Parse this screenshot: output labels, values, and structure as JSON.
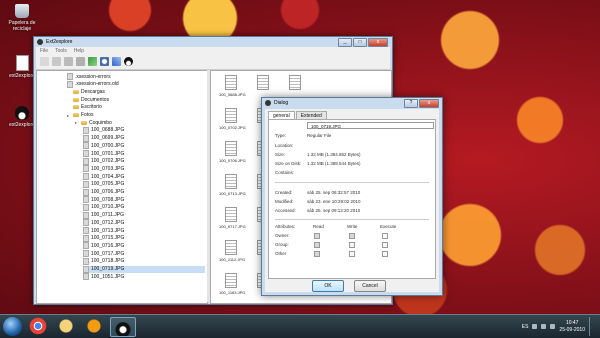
{
  "desktop": {
    "icons": [
      {
        "label": "Papelera de reciclaje"
      },
      {
        "label": "ext2explore"
      },
      {
        "label": "ext2explore"
      }
    ]
  },
  "main_window": {
    "title": "Ext2explore",
    "menu": [
      "File",
      "Tools",
      "Help"
    ],
    "close_label": "x",
    "tree": [
      {
        "label": ".xsession-errors",
        "type": "file",
        "indent": 0
      },
      {
        "label": ".xsession-errors.old",
        "type": "file",
        "indent": 0
      },
      {
        "label": "Descargas",
        "type": "folder",
        "indent": 0
      },
      {
        "label": "Documentos",
        "type": "folder",
        "indent": 0
      },
      {
        "label": "Escritorio",
        "type": "folder",
        "indent": 0
      },
      {
        "label": "Fotos",
        "type": "folder",
        "indent": 0
      },
      {
        "label": "Coquimbo",
        "type": "folder",
        "indent": 1
      },
      {
        "label": "100_0688.JPG",
        "type": "file",
        "indent": 2
      },
      {
        "label": "100_0699.JPG",
        "type": "file",
        "indent": 2
      },
      {
        "label": "100_0700.JPG",
        "type": "file",
        "indent": 2
      },
      {
        "label": "100_0701.JPG",
        "type": "file",
        "indent": 2
      },
      {
        "label": "100_0702.JPG",
        "type": "file",
        "indent": 2
      },
      {
        "label": "100_0703.JPG",
        "type": "file",
        "indent": 2
      },
      {
        "label": "100_0704.JPG",
        "type": "file",
        "indent": 2
      },
      {
        "label": "100_0705.JPG",
        "type": "file",
        "indent": 2
      },
      {
        "label": "100_0706.JPG",
        "type": "file",
        "indent": 2
      },
      {
        "label": "100_0708.JPG",
        "type": "file",
        "indent": 2
      },
      {
        "label": "100_0710.JPG",
        "type": "file",
        "indent": 2
      },
      {
        "label": "100_0711.JPG",
        "type": "file",
        "indent": 2
      },
      {
        "label": "100_0712.JPG",
        "type": "file",
        "indent": 2
      },
      {
        "label": "100_0713.JPG",
        "type": "file",
        "indent": 2
      },
      {
        "label": "100_0715.JPG",
        "type": "file",
        "indent": 2
      },
      {
        "label": "100_0716.JPG",
        "type": "file",
        "indent": 2
      },
      {
        "label": "100_0717.JPG",
        "type": "file",
        "indent": 2
      },
      {
        "label": "100_0718.JPG",
        "type": "file",
        "indent": 2
      },
      {
        "label": "100_0719.JPG",
        "type": "file",
        "indent": 2,
        "selected": true
      },
      {
        "label": "100_1051.JPG",
        "type": "file",
        "indent": 2
      }
    ],
    "thumbs": [
      {
        "label": ""
      },
      {
        "label": ""
      },
      {
        "label": ""
      },
      {
        "label": "100_0688.JPG"
      },
      {
        "label": ""
      },
      {
        "label": ""
      },
      {
        "label": ""
      },
      {
        "label": ""
      },
      {
        "label": ""
      },
      {
        "label": "100_0702.JPG"
      },
      {
        "label": ""
      },
      {
        "label": ""
      },
      {
        "label": ""
      },
      {
        "label": ""
      },
      {
        "label": ""
      },
      {
        "label": "100_0706.JPG"
      },
      {
        "label": ""
      },
      {
        "label": ""
      },
      {
        "label": ""
      },
      {
        "label": ""
      },
      {
        "label": ""
      },
      {
        "label": "100_0713.JPG"
      },
      {
        "label": ""
      },
      {
        "label": ""
      },
      {
        "label": ""
      },
      {
        "label": ""
      },
      {
        "label": ""
      },
      {
        "label": "100_0717.JPG"
      },
      {
        "label": ""
      },
      {
        "label": ""
      },
      {
        "label": ""
      },
      {
        "label": ""
      },
      {
        "label": ""
      },
      {
        "label": "100_1112.JPG"
      },
      {
        "label": ""
      },
      {
        "label": ""
      },
      {
        "label": ""
      },
      {
        "label": ""
      },
      {
        "label": ""
      },
      {
        "label": "100_1163.JPG"
      },
      {
        "label": ""
      },
      {
        "label": ""
      }
    ]
  },
  "dialog": {
    "title": "Dialog",
    "help_label": "?",
    "close_label": "x",
    "tabs": [
      "general",
      "Extended"
    ],
    "filename": "100_0719.JPG",
    "fields": {
      "type_label": "Type:",
      "type_value": "Regular File",
      "location_label": "Location:",
      "location_value": "",
      "size_label": "Size:",
      "size_value": "1.32 MB (1.384.862 Bytes)",
      "size_disk_label": "Size on Disk:",
      "size_disk_value": "1.32 MB (1.388.544 Bytes)",
      "contains_label": "Contains:",
      "contains_value": "",
      "created_label": "Created:",
      "created_value": "sáb 25. sep 06:32:57 2010",
      "modified_label": "Modified:",
      "modified_value": "sáb 23. ene 10:29:02 2010",
      "accessed_label": "Accessed:",
      "accessed_value": "sáb 25. sep 09:13:20 2010"
    },
    "perm_headers": [
      "Attributes:",
      "Read",
      "Write",
      "Execute"
    ],
    "perm_rows": [
      "Owner:",
      "Group:",
      "Other"
    ],
    "ok_label": "OK",
    "cancel_label": "Cancel"
  },
  "taskbar": {
    "lang": "ES",
    "time": "10:47",
    "date": "25-09-2010"
  }
}
